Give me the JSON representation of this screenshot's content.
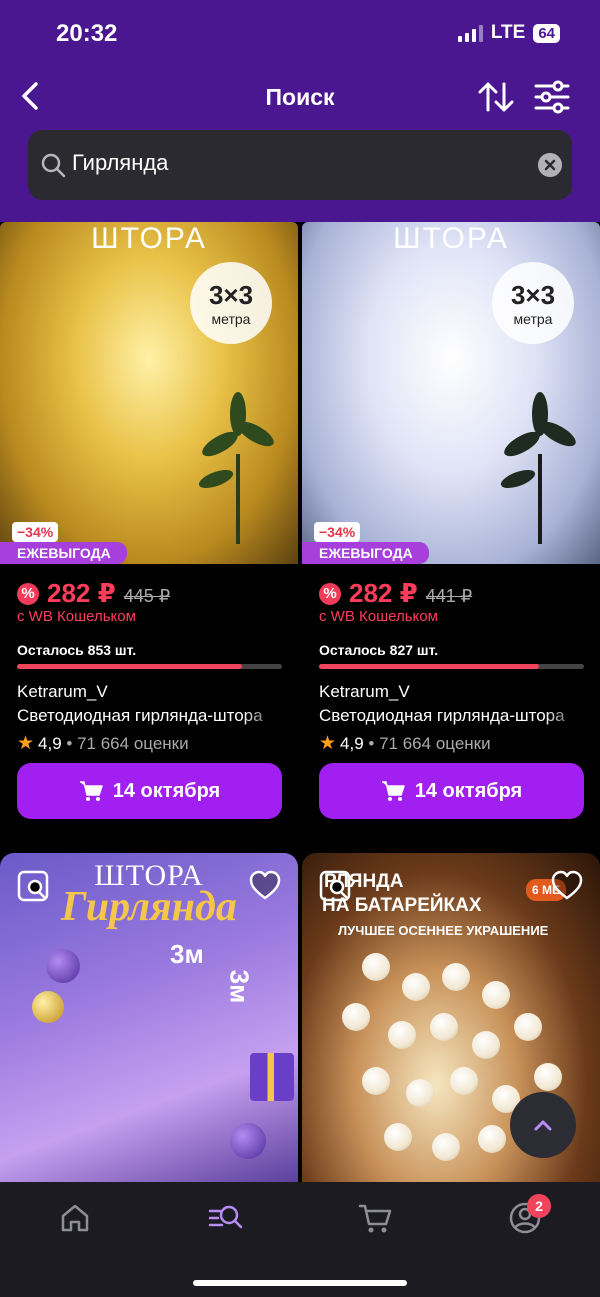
{
  "status": {
    "time": "20:32",
    "network": "LTE",
    "battery": "64"
  },
  "header": {
    "title": "Поиск"
  },
  "search": {
    "value": "Гирлянда"
  },
  "products": [
    {
      "image_title": "ШТОРА",
      "size": "3×3",
      "size_unit": "метра",
      "discount": "−34%",
      "promo": "ЕЖЕВЫГОДА",
      "price": "282 ₽",
      "old_price": "445 ₽",
      "wallet_note": "с WB Кошельком",
      "stock": "Осталось 853 шт.",
      "stock_level": 0.85,
      "brand": "Ketrarum_V",
      "name": "Светодиодная гирлянда-штора",
      "rating": "4,9",
      "reviews": "• 71 664 оценки",
      "delivery": "14 октября"
    },
    {
      "image_title": "ШТОРА",
      "size": "3×3",
      "size_unit": "метра",
      "discount": "−34%",
      "promo": "ЕЖЕВЫГОДА",
      "price": "282 ₽",
      "old_price": "441 ₽",
      "wallet_note": "с WB Кошельком",
      "stock": "Осталось 827 шт.",
      "stock_level": 0.83,
      "brand": "Ketrarum_V",
      "name": "Светодиодная гирлянда-штора",
      "rating": "4,9",
      "reviews": "• 71 664 оценки",
      "delivery": "14 октября"
    }
  ],
  "card3": {
    "line1": "ШТОРА",
    "line2": "Гирлянда",
    "dim1": "3м",
    "dim2": "3м"
  },
  "card4": {
    "line1": "РЛЯНДА",
    "line2": "НА БАТАРЕЙКАХ",
    "line3": "ЛУЧШЕЕ ОСЕННЕЕ УКРАШЕНИЕ",
    "badge": "6 МЕ"
  },
  "tabbar": {
    "profile_badge": "2"
  },
  "colors": {
    "header_bg": "#4a1790",
    "accent": "#a11ff0",
    "price": "#ff3d5a",
    "promo": "#a63fdc"
  }
}
